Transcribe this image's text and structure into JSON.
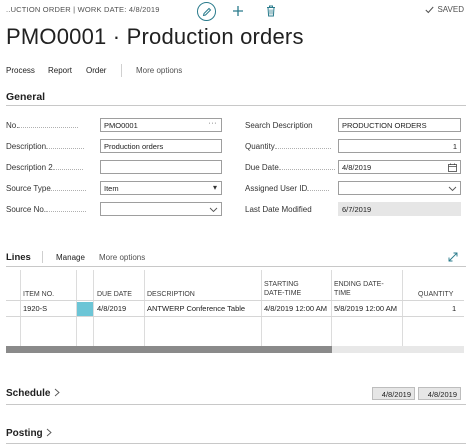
{
  "topbar": {
    "caption": "..UCTION ORDER | WORK DATE: 4/8/2019",
    "saved": "SAVED"
  },
  "page": {
    "title": "PMO0001 · Production orders"
  },
  "actions": [
    {
      "label": "Process"
    },
    {
      "label": "Report"
    },
    {
      "label": "Order"
    },
    {
      "label": "More options"
    }
  ],
  "general": {
    "heading": "General",
    "fields": {
      "no": {
        "label": "No.",
        "value": "PMO0001"
      },
      "description": {
        "label": "Description",
        "value": "Production orders"
      },
      "description2": {
        "label": "Description 2",
        "value": ""
      },
      "source_type": {
        "label": "Source Type",
        "value": "Item"
      },
      "source_no": {
        "label": "Source No.",
        "value": ""
      },
      "search_description": {
        "label": "Search Description",
        "value": "PRODUCTION ORDERS"
      },
      "quantity": {
        "label": "Quantity",
        "value": "1"
      },
      "due_date": {
        "label": "Due Date",
        "value": "4/8/2019"
      },
      "assigned_user": {
        "label": "Assigned User ID",
        "value": ""
      },
      "last_modified": {
        "label": "Last Date Modified",
        "value": "6/7/2019"
      }
    }
  },
  "lines": {
    "title": "Lines",
    "manage": "Manage",
    "more": "More options",
    "columns": {
      "item_no": "ITEM NO.",
      "due_date": "DUE DATE",
      "description": "DESCRIPTION",
      "starting_l1": "STARTING",
      "starting_l2": "DATE-TIME",
      "ending_l1": "ENDING DATE-",
      "ending_l2": "TIME",
      "quantity": "QUANTITY"
    },
    "rows": [
      {
        "item_no": "1920-S",
        "due_date": "4/8/2019",
        "description": "ANTWERP Conference Table",
        "starting": "4/8/2019 12:00 AM",
        "ending": "5/8/2019 12:00 AM",
        "quantity": "1"
      }
    ]
  },
  "schedule": {
    "title": "Schedule",
    "date1": "4/8/2019",
    "date2": "4/8/2019"
  },
  "posting": {
    "title": "Posting"
  },
  "colors": {
    "accent": "#2a7b8c",
    "focus": "#6cc5d6",
    "scroll_thumb": "#8a8a8a"
  }
}
